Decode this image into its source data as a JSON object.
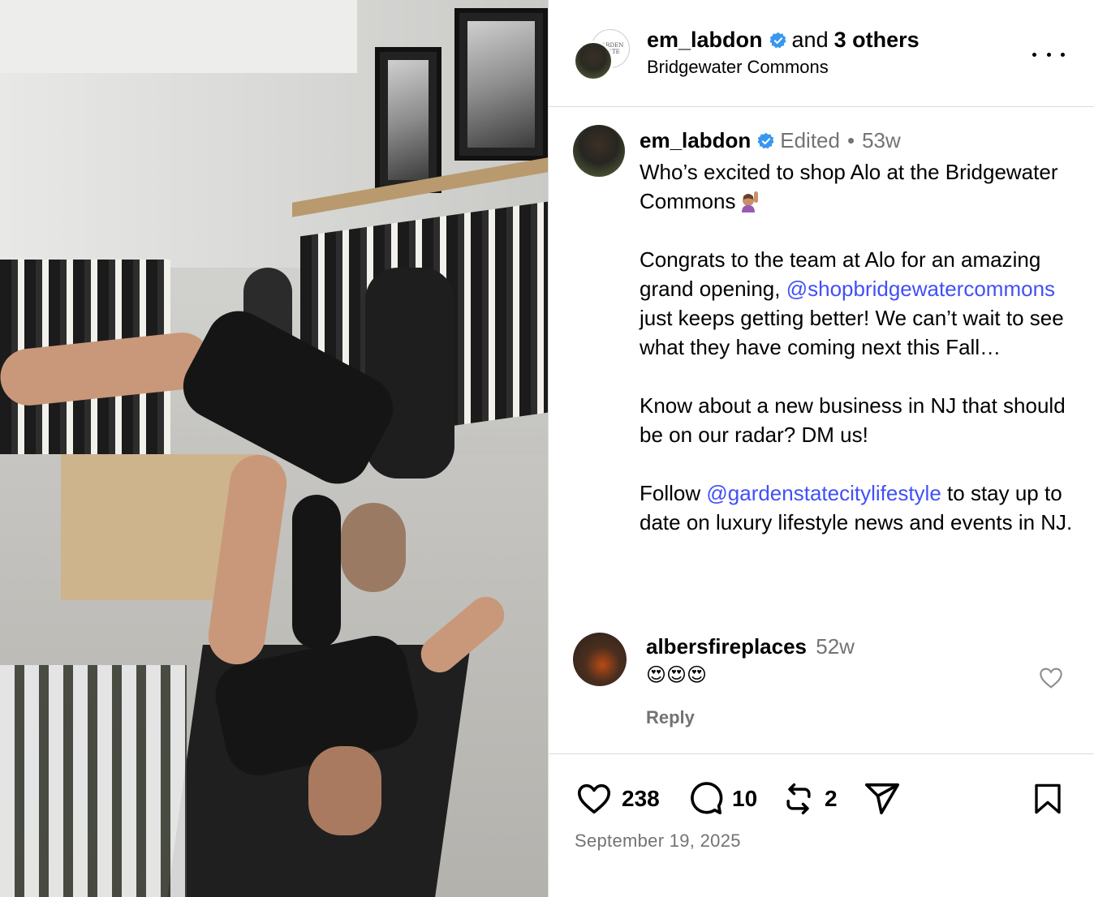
{
  "header": {
    "username": "em_labdon",
    "and_text": "and",
    "others_text": "3 others",
    "location": "Bridgewater Commons",
    "collab_avatar_text": "GARDEN STATE"
  },
  "caption": {
    "username": "em_labdon",
    "edited_label": "Edited",
    "separator": "•",
    "time": "53w",
    "para1": "Who’s excited to shop Alo at the Bridgewater Commons",
    "para2_pre": "Congrats to the team at Alo for an amazing grand opening,",
    "para2_mention": "@shopbridgewatercommons",
    "para2_post": "just keeps getting better! We can’t wait to see what they have coming next this Fall…",
    "para3": "Know about a new business in NJ that should be on our radar? DM us!",
    "para4_pre": "Follow",
    "para4_mention": "@gardenstatecitylifestyle",
    "para4_post": "to stay up to date on luxury lifestyle news and events in NJ."
  },
  "comment": {
    "username": "albersfireplaces",
    "time": "52w",
    "text": "😍😍😍",
    "reply_label": "Reply"
  },
  "actions": {
    "likes": "238",
    "comments": "10",
    "reposts": "2",
    "date": "September 19, 2025"
  },
  "colors": {
    "mention": "#4150f7",
    "verified": "#3897f0",
    "muted": "#737373",
    "divider": "#dbdbdb"
  },
  "icons": [
    "verified-badge-icon",
    "more-options-icon",
    "heart-icon",
    "comment-icon",
    "repost-icon",
    "share-icon",
    "bookmark-icon"
  ]
}
